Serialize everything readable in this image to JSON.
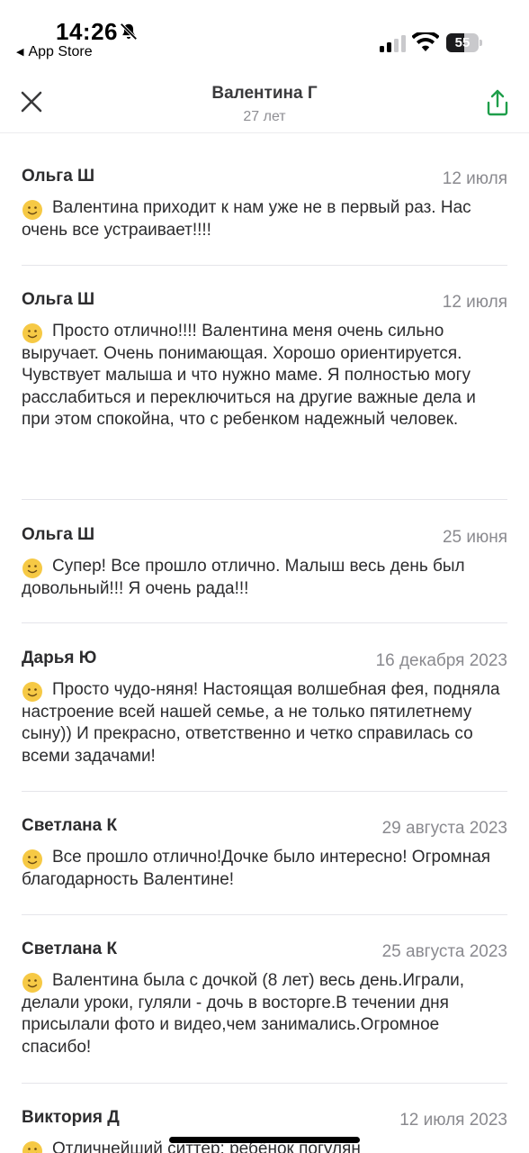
{
  "status_bar": {
    "time": "14:26",
    "back_app": "App Store",
    "battery": "55",
    "battery_level": 0.55
  },
  "header": {
    "title": "Валентина  Г",
    "subtitle": "27 лет"
  },
  "colors": {
    "accent": "#1e9e4a",
    "emoji": "#f6c945"
  },
  "reviews": [
    {
      "author": "Ольга Ш",
      "date": "12 июля",
      "text": "Валентина приходит к нам уже не в первый раз. Нас очень все устраивает!!!!"
    },
    {
      "author": "Ольга Ш",
      "date": "12 июля",
      "text": "Просто отлично!!!! Валентина меня очень сильно выручает. Очень понимающая. Хорошо ориентируется. Чувствует малыша и что нужно маме. Я полностью могу расслабиться и переключиться на другие важные дела и при этом спокойна, что с ребенком надежный человек."
    },
    {
      "author": "Ольга Ш",
      "date": "25 июня",
      "text": "Супер! Все прошло отлично. Малыш весь день был довольный!!! Я очень рада!!!"
    },
    {
      "author": "Дарья Ю",
      "date": "16 декабря 2023",
      "text": "Просто чудо-няня! Настоящая волшебная фея, подняла настроение всей нашей семье, а не только пятилетнему сыну)) И прекрасно, ответственно и четко справилась со всеми задачами!"
    },
    {
      "author": "Светлана  К",
      "date": "29 августа 2023",
      "text": "Все прошло отлично!Дочке было интересно! Огромная благодарность Валентине!"
    },
    {
      "author": "Светлана  К",
      "date": "25 августа 2023",
      "text": "Валентина была с дочкой (8 лет) весь день.Играли, делали уроки, гуляли - дочь в восторге.В течении дня присылали фото и видео,чем занимались.Огромное спасибо!"
    },
    {
      "author": "Виктория Д",
      "date": "12 июля 2023",
      "text": "Отличнейший ситтер: ребёнок погулян"
    }
  ]
}
